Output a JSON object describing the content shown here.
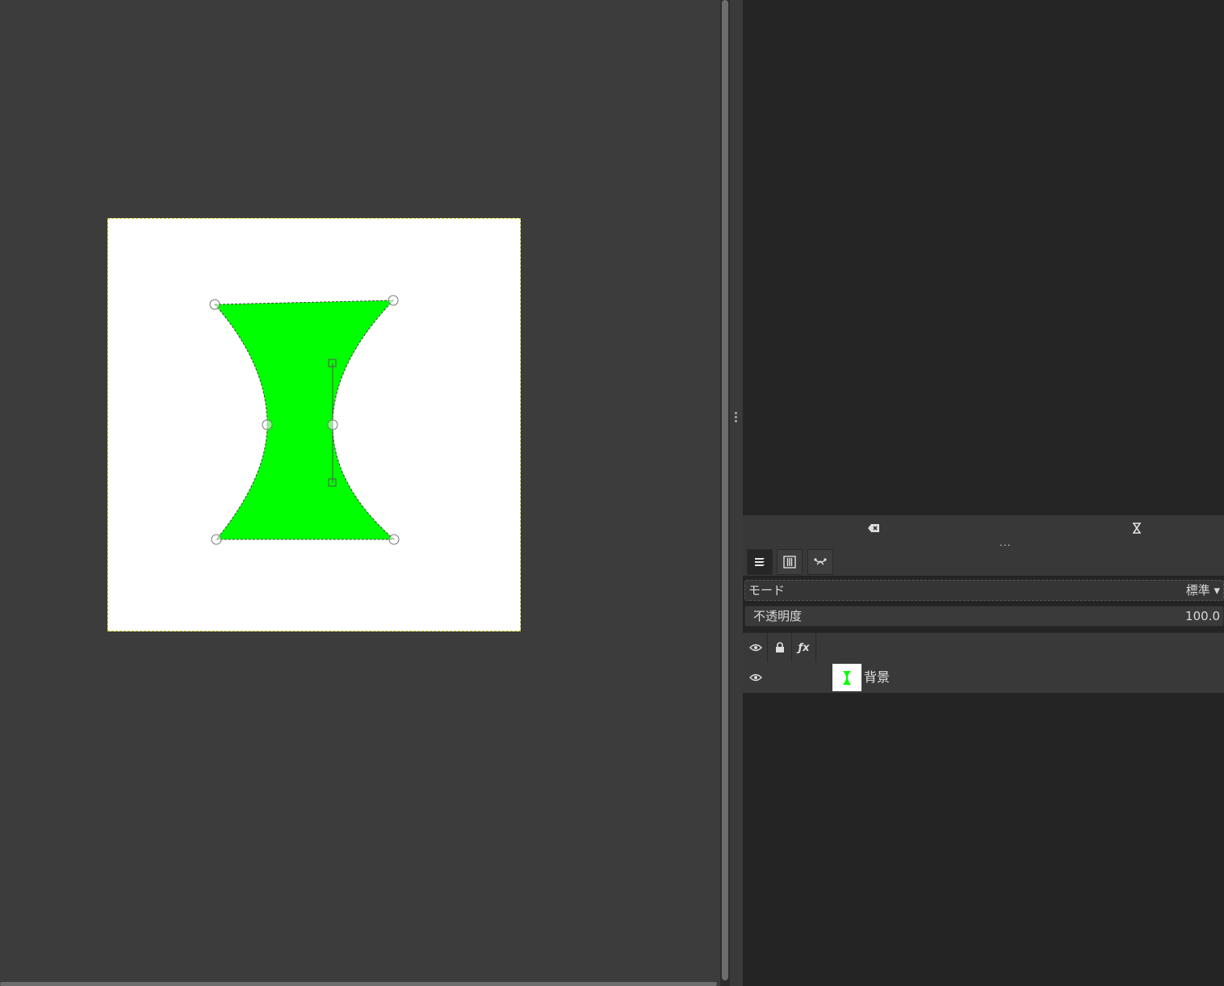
{
  "window": {
    "canvas_background": "#3c3c3c",
    "image_background": "#ffffff",
    "shape_fill": "#00ff00",
    "panel_background": "#242424"
  },
  "dock": {
    "icons": [
      "clear-icon",
      "hourglass-icon"
    ],
    "more_label": "..."
  },
  "tabs": [
    {
      "name": "layers-tab",
      "icon": "layers-icon",
      "active": true
    },
    {
      "name": "channels-tab",
      "icon": "channels-icon",
      "active": false
    },
    {
      "name": "paths-tab",
      "icon": "paths-icon",
      "active": false
    }
  ],
  "mode": {
    "label": "モード",
    "value": "標準 ▾"
  },
  "opacity": {
    "label": "不透明度",
    "value": "100.0"
  },
  "layers_header": {
    "fx_label": "ƒx"
  },
  "layers": [
    {
      "name": "背景",
      "visible": true
    }
  ]
}
